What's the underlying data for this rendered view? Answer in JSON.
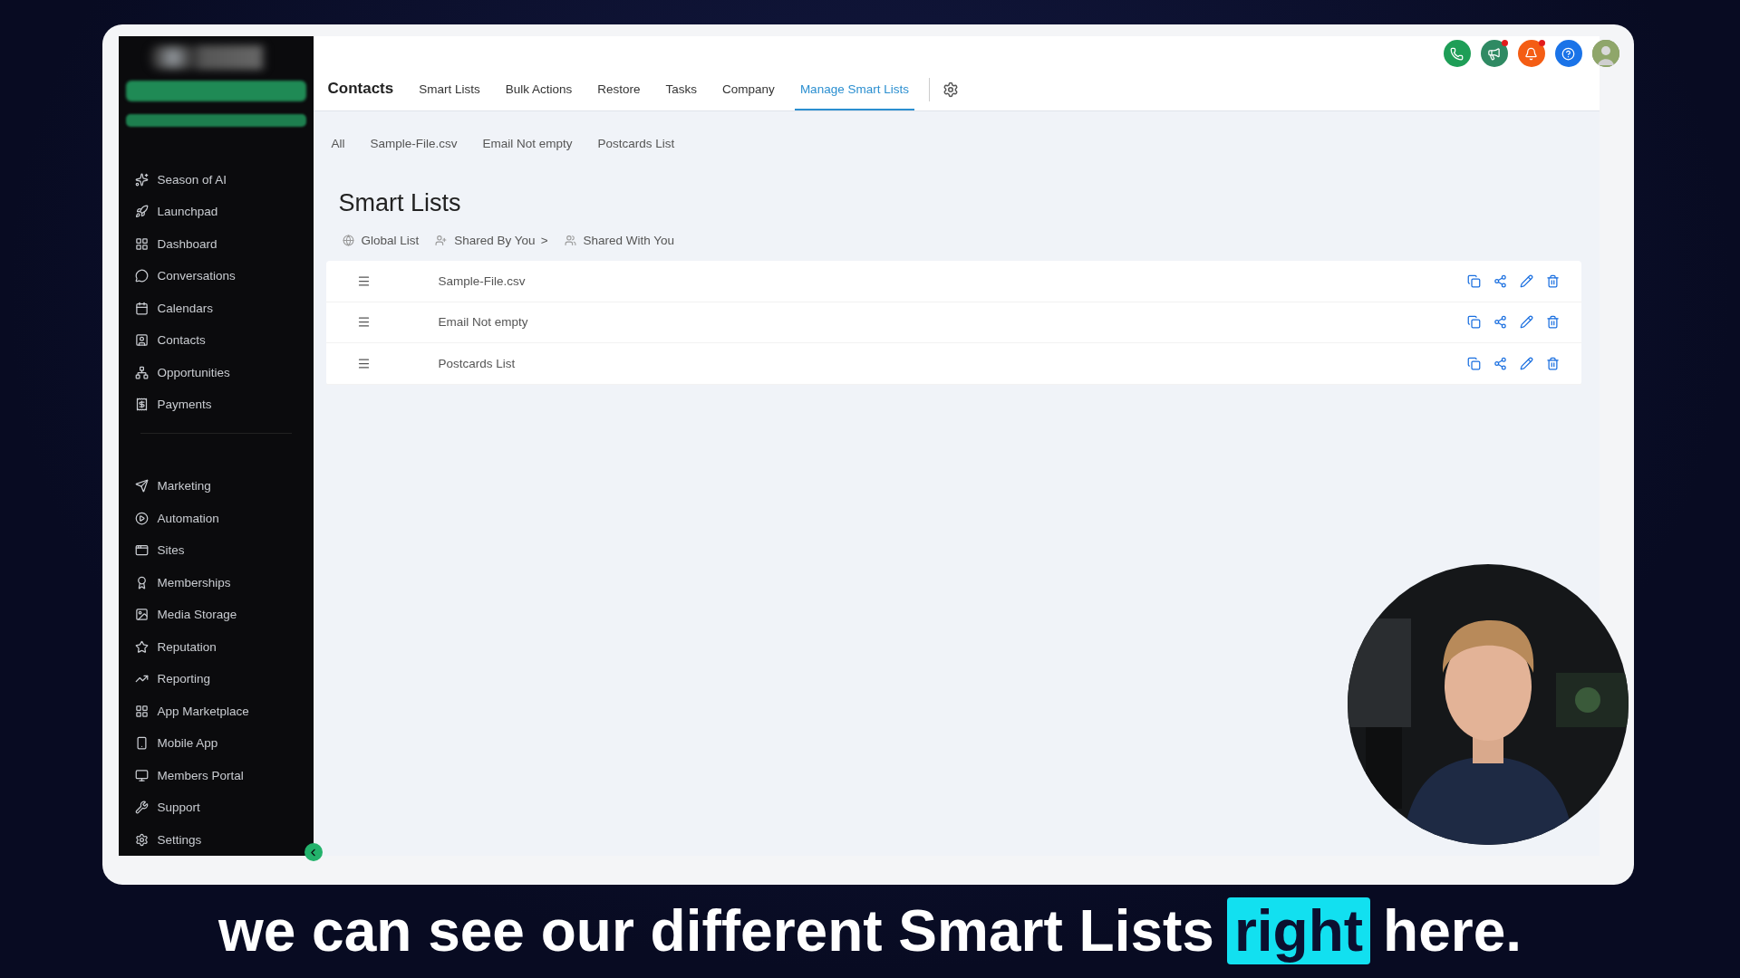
{
  "sidebar": {
    "groups": [
      {
        "items": [
          "Season of AI",
          "Launchpad",
          "Dashboard",
          "Conversations",
          "Calendars",
          "Contacts",
          "Opportunities",
          "Payments"
        ]
      },
      {
        "items": [
          "Marketing",
          "Automation",
          "Sites",
          "Memberships",
          "Media Storage",
          "Reputation",
          "Reporting",
          "App Marketplace",
          "Mobile App",
          "Members Portal",
          "Support",
          "Settings"
        ]
      }
    ]
  },
  "header": {
    "title": "Contacts",
    "tabs": [
      {
        "label": "Smart Lists",
        "selected": false
      },
      {
        "label": "Bulk Actions",
        "selected": false
      },
      {
        "label": "Restore",
        "selected": false
      },
      {
        "label": "Tasks",
        "selected": false
      },
      {
        "label": "Company",
        "selected": false
      },
      {
        "label": "Manage Smart Lists",
        "selected": true
      }
    ],
    "actions": [
      {
        "kind": "phone",
        "color": "#1e9e57",
        "badge": false
      },
      {
        "kind": "announcements",
        "color": "#2f8a63",
        "badge": true
      },
      {
        "kind": "notifications",
        "color": "#f45d14",
        "badge": true
      },
      {
        "kind": "help",
        "color": "#1a73e8",
        "badge": false
      },
      {
        "kind": "avatar"
      }
    ]
  },
  "sub_tabs": [
    "All",
    "Sample-File.csv",
    "Email Not empty",
    "Postcards List"
  ],
  "page_title": "Smart Lists",
  "filters": [
    {
      "kind": "global",
      "label": "Global List"
    },
    {
      "kind": "shared_by",
      "label": "Shared By You",
      "suffix": ">"
    },
    {
      "kind": "shared_with",
      "label": "Shared With You"
    }
  ],
  "lists": [
    {
      "name": "Sample-File.csv"
    },
    {
      "name": "Email Not empty"
    },
    {
      "name": "Postcards List"
    }
  ],
  "caption": {
    "before": "we can see our different Smart Lists",
    "highlight": "right",
    "after": "here."
  }
}
